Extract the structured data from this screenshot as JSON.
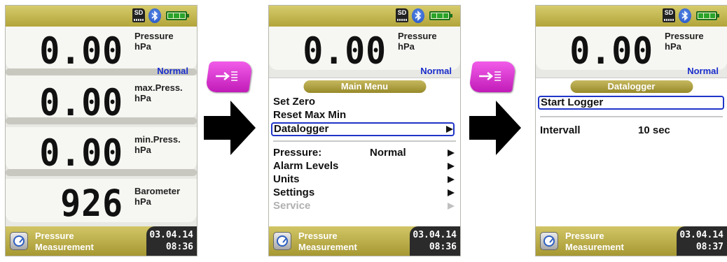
{
  "status_icons": {
    "sd": "SD",
    "bluetooth": "bluetooth-icon",
    "battery": "battery-icon"
  },
  "screen1": {
    "rows": [
      {
        "value": "0.00",
        "label": "Pressure",
        "unit": "hPa"
      },
      {
        "value": "0.00",
        "label": "max.Press.",
        "unit": "hPa"
      },
      {
        "value": "0.00",
        "label": "min.Press.",
        "unit": "hPa"
      },
      {
        "value": "926",
        "label": "Barometer",
        "unit": "hPa"
      }
    ],
    "mode": "Normal",
    "footer": {
      "title_line1": "Pressure",
      "title_line2": "Measurement",
      "date": "03.04.14",
      "time": "08:36"
    }
  },
  "screen2": {
    "value": "0.00",
    "label": "Pressure",
    "unit": "hPa",
    "mode": "Normal",
    "menu_title": "Main Menu",
    "items": [
      {
        "label": "Set Zero"
      },
      {
        "label": "Reset Max Min"
      },
      {
        "label": "Datalogger"
      },
      {
        "label": "Pressure:",
        "value": "Normal"
      },
      {
        "label": "Alarm Levels"
      },
      {
        "label": "Units"
      },
      {
        "label": "Settings"
      },
      {
        "label": "Service"
      }
    ],
    "footer": {
      "title_line1": "Pressure",
      "title_line2": "Measurement",
      "date": "03.04.14",
      "time": "08:36"
    }
  },
  "screen3": {
    "value": "0.00",
    "label": "Pressure",
    "unit": "hPa",
    "mode": "Normal",
    "menu_title": "Datalogger",
    "items": [
      {
        "label": "Start Logger"
      },
      {
        "label": "Intervall",
        "value": "10 sec"
      }
    ],
    "footer": {
      "title_line1": "Pressure",
      "title_line2": "Measurement",
      "date": "03.04.14",
      "time": "08:37"
    }
  },
  "colors": {
    "accent_magenta": "#d62ccf",
    "selection_blue": "#2035c8",
    "mode_blue": "#1a2ecc",
    "bar_gold": "#c2b550"
  }
}
